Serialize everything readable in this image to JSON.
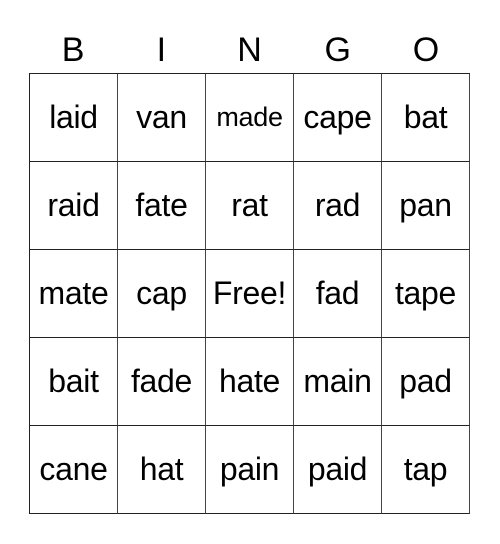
{
  "header": [
    "B",
    "I",
    "N",
    "G",
    "O"
  ],
  "board": [
    [
      "laid",
      "van",
      "made",
      "cape",
      "bat"
    ],
    [
      "raid",
      "fate",
      "rat",
      "rad",
      "pan"
    ],
    [
      "mate",
      "cap",
      "Free!",
      "fad",
      "tape"
    ],
    [
      "bait",
      "fade",
      "hate",
      "main",
      "pad"
    ],
    [
      "cane",
      "hat",
      "pain",
      "paid",
      "tap"
    ]
  ]
}
